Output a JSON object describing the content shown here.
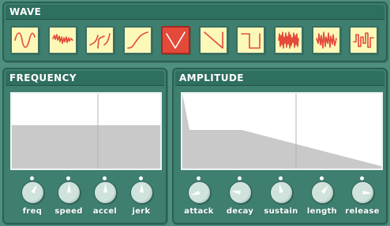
{
  "wave": {
    "title": "WAVE",
    "selected_index": 4,
    "buttons": [
      {
        "icon": "sine-wave-icon"
      },
      {
        "icon": "noisy-wave-icon"
      },
      {
        "icon": "tangent-wave-icon"
      },
      {
        "icon": "whistle-wave-icon"
      },
      {
        "icon": "triangle-wave-icon"
      },
      {
        "icon": "sawtooth-wave-icon"
      },
      {
        "icon": "square-wave-icon"
      },
      {
        "icon": "noise-wave-icon"
      },
      {
        "icon": "breaker-wave-icon"
      },
      {
        "icon": "bitnoise-wave-icon"
      }
    ]
  },
  "frequency": {
    "title": "FREQUENCY",
    "knobs": [
      {
        "label": "freq",
        "value": 0.6
      },
      {
        "label": "speed",
        "value": 0.5
      },
      {
        "label": "accel",
        "value": 0.5
      },
      {
        "label": "jerk",
        "value": 0.5
      }
    ]
  },
  "amplitude": {
    "title": "AMPLITUDE",
    "knobs": [
      {
        "label": "attack",
        "value": 0.1
      },
      {
        "label": "decay",
        "value": 0.2
      },
      {
        "label": "sustain",
        "value": 0.45
      },
      {
        "label": "length",
        "value": 0.65
      },
      {
        "label": "release",
        "value": 0.85
      }
    ]
  },
  "colors": {
    "background": "#4e8f7e",
    "panel": "#3e7f6f",
    "button": "#fcf8b8",
    "button_selected": "#e34a3a",
    "icon_stroke": "#e34a3a",
    "icon_stroke_selected": "#ffffff"
  }
}
